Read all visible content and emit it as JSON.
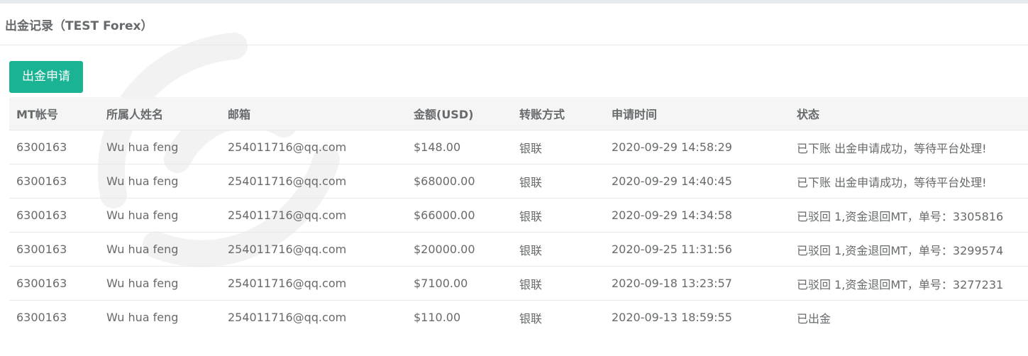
{
  "panel": {
    "title": "出金记录（TEST Forex）",
    "apply_button_label": "出金申请"
  },
  "table": {
    "headers": [
      "MT帐号",
      "所属人姓名",
      "邮箱",
      "金额(USD)",
      "转账方式",
      "申请时间",
      "状态"
    ],
    "rows": [
      [
        "6300163",
        "Wu hua feng",
        "254011716@qq.com",
        "$148.00",
        "银联",
        "2020-09-29 14:58:29",
        "已下账 出金申请成功，等待平台处理!"
      ],
      [
        "6300163",
        "Wu hua feng",
        "254011716@qq.com",
        "$68000.00",
        "银联",
        "2020-09-29 14:40:45",
        "已下账 出金申请成功，等待平台处理!"
      ],
      [
        "6300163",
        "Wu hua feng",
        "254011716@qq.com",
        "$66000.00",
        "银联",
        "2020-09-29 14:34:58",
        "已驳回 1,资金退回MT，单号：3305816"
      ],
      [
        "6300163",
        "Wu hua feng",
        "254011716@qq.com",
        "$20000.00",
        "银联",
        "2020-09-25 11:31:56",
        "已驳回 1,资金退回MT，单号：3299574"
      ],
      [
        "6300163",
        "Wu hua feng",
        "254011716@qq.com",
        "$7100.00",
        "银联",
        "2020-09-18 13:23:57",
        "已驳回 1,资金退回MT，单号：3277231"
      ],
      [
        "6300163",
        "Wu hua feng",
        "254011716@qq.com",
        "$110.00",
        "银联",
        "2020-09-13 18:59:55",
        "已出金"
      ]
    ]
  },
  "colors": {
    "accent": "#1ab394",
    "text": "#676a6c",
    "header_bg": "#f5f5f5",
    "border": "#e7eaec"
  }
}
